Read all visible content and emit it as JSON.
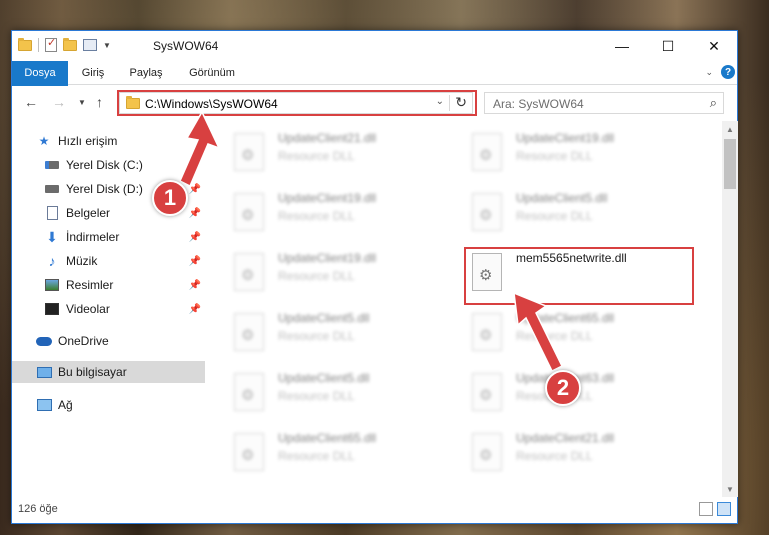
{
  "window": {
    "title": "SysWOW64"
  },
  "ribbon": {
    "tabs": [
      {
        "label": "Dosya"
      },
      {
        "label": "Giriş"
      },
      {
        "label": "Paylaş"
      },
      {
        "label": "Görünüm"
      }
    ],
    "help": "?"
  },
  "address": {
    "path": "C:\\Windows\\SysWOW64"
  },
  "search": {
    "placeholder": "Ara: SysWOW64"
  },
  "sidebar": {
    "items": [
      {
        "label": "Hızlı erişim",
        "icon": "star-icon"
      },
      {
        "label": "Yerel Disk (C:)",
        "icon": "drive-icon"
      },
      {
        "label": "Yerel Disk (D:)",
        "icon": "drive-icon"
      },
      {
        "label": "Belgeler",
        "icon": "documents-icon"
      },
      {
        "label": "İndirmeler",
        "icon": "download-icon"
      },
      {
        "label": "Müzik",
        "icon": "music-icon"
      },
      {
        "label": "Resimler",
        "icon": "pictures-icon"
      },
      {
        "label": "Videolar",
        "icon": "videos-icon"
      },
      {
        "label": "OneDrive",
        "icon": "cloud-icon"
      },
      {
        "label": "Bu bilgisayar",
        "icon": "computer-icon"
      },
      {
        "label": "Ağ",
        "icon": "network-icon"
      }
    ]
  },
  "files": [
    {
      "name": "UpdateClient21.dll",
      "type": "Resource DLL"
    },
    {
      "name": "UpdateClient19.dll",
      "type": "Resource DLL"
    },
    {
      "name": "UpdateClient19.dll",
      "type": "Resource DLL"
    },
    {
      "name": "UpdateClient5.dll",
      "type": "Resource DLL"
    },
    {
      "name": "UpdateClient19.dll",
      "type": "Resource DLL"
    },
    {
      "name": "mem5565netwrite.dll",
      "type": ""
    },
    {
      "name": "UpdateClient5.dll",
      "type": "Resource DLL"
    },
    {
      "name": "UpdateClient65.dll",
      "type": "Resource DLL"
    },
    {
      "name": "UpdateClient5.dll",
      "type": "Resource DLL"
    },
    {
      "name": "UpdateClient63.dll",
      "type": "Resource DLL"
    },
    {
      "name": "UpdateClient65.dll",
      "type": "Resource DLL"
    },
    {
      "name": "UpdateClient21.dll",
      "type": "Resource DLL"
    }
  ],
  "status": {
    "count": "126 öğe"
  },
  "annotations": {
    "step1": "1",
    "step2": "2",
    "color": "#d84040"
  }
}
